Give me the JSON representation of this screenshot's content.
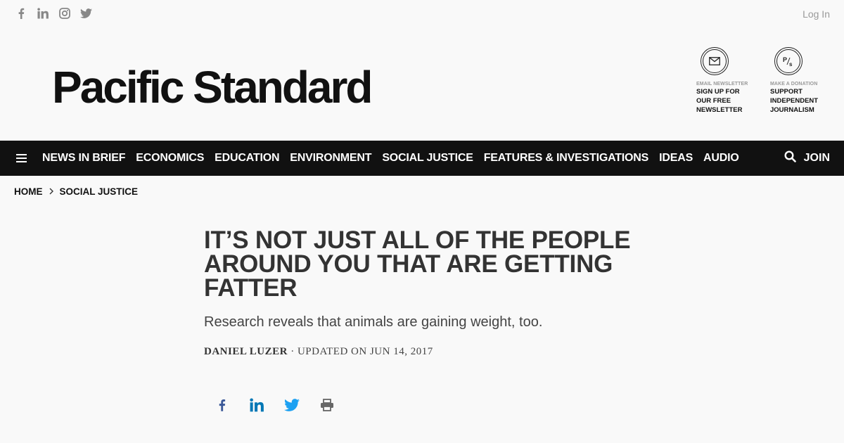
{
  "header": {
    "social_icons": [
      "facebook-icon",
      "linkedin-icon",
      "instagram-icon",
      "twitter-icon"
    ],
    "login_label": "Log In",
    "logo_text": "Pacific Standard"
  },
  "promos": {
    "newsletter": {
      "eyebrow": "EMAIL NEWSLETTER",
      "line1": "SIGN UP FOR",
      "line2": "OUR FREE",
      "line3": "NEWSLETTER"
    },
    "donate": {
      "eyebrow": "MAKE A DONATION",
      "line1": "SUPPORT",
      "line2": "INDEPENDENT",
      "line3": "JOURNALISM",
      "badge": "PS"
    }
  },
  "nav": {
    "items": [
      "NEWS IN BRIEF",
      "ECONOMICS",
      "EDUCATION",
      "ENVIRONMENT",
      "SOCIAL JUSTICE",
      "FEATURES & INVESTIGATIONS",
      "IDEAS",
      "AUDIO"
    ],
    "join_label": "JOIN"
  },
  "breadcrumb": {
    "home": "HOME",
    "section": "SOCIAL JUSTICE"
  },
  "article": {
    "title": "IT’S NOT JUST ALL OF THE PEOPLE AROUND YOU THAT ARE GETTING FATTER",
    "dek": "Research reveals that animals are gaining weight, too.",
    "author": "DANIEL LUZER",
    "updated": " · UPDATED ON JUN 14, 2017"
  },
  "colors": {
    "nav_bg": "#111111",
    "facebook": "#3b5998",
    "linkedin": "#0077b5",
    "twitter": "#1da1f2"
  }
}
